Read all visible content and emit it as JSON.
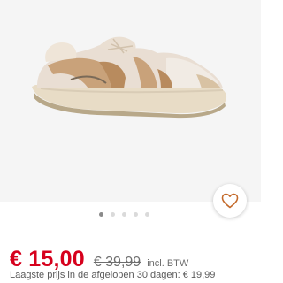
{
  "product": {
    "image_alt": "Beige sneaker"
  },
  "wishlist": {
    "icon": "heart-icon",
    "color": "#c46a2b"
  },
  "carousel": {
    "total": 5,
    "active_index": 0
  },
  "pricing": {
    "sale_price": "€ 15,00",
    "original_price": "€ 39,99",
    "vat_note": "incl. BTW",
    "lowest_price_note": "Laagste prijs in de afgelopen 30 dagen: € 19,99",
    "sale_color": "#d6001c"
  }
}
